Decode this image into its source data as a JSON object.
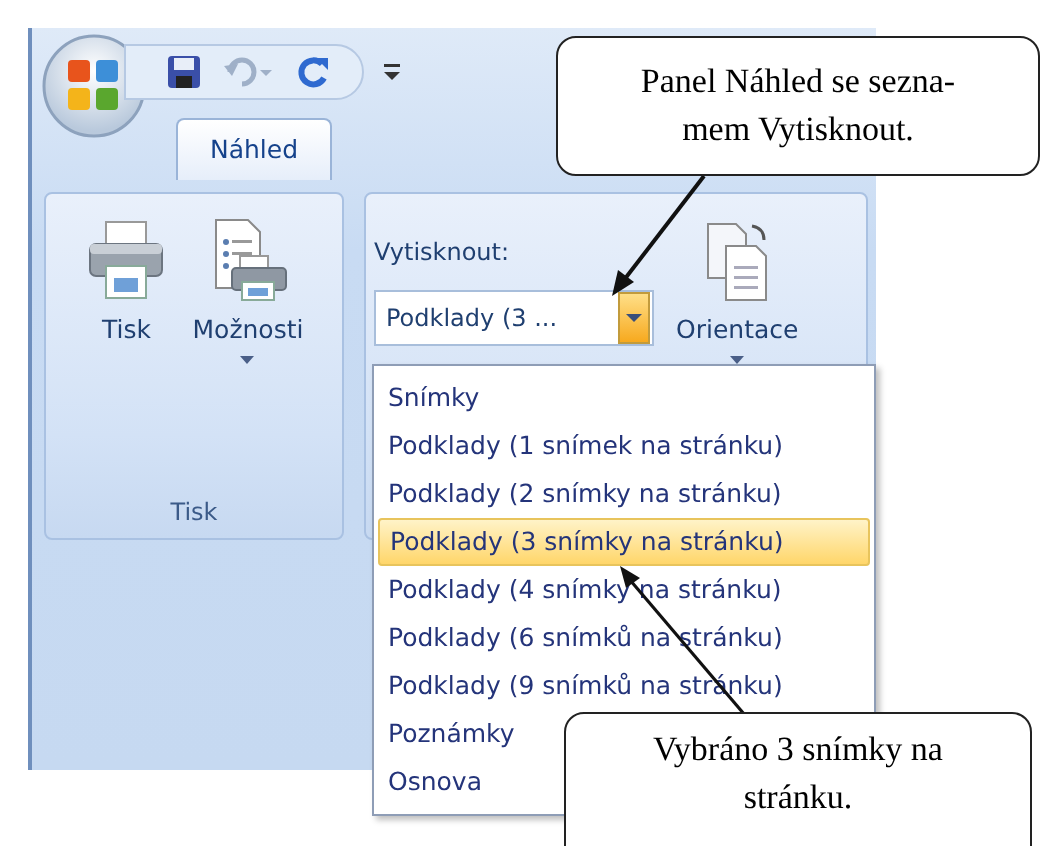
{
  "tabs": [
    {
      "label": "Náhled",
      "selected": true
    }
  ],
  "ribbon": {
    "print_group": {
      "label": "Tisk",
      "buttons": [
        {
          "label": "Tisk",
          "kind": "printer",
          "has_menu": false
        },
        {
          "label": "Možnosti",
          "kind": "options",
          "has_menu": true
        }
      ]
    },
    "layout_group": {
      "combo_label": "Vytisknout:",
      "combo_value": "Podklady (3 ...",
      "buttons": [
        {
          "label": "Orientace",
          "kind": "orientation",
          "has_menu": true
        }
      ]
    }
  },
  "dropdown": {
    "items": [
      {
        "label": "Snímky",
        "selected": false
      },
      {
        "label": "Podklady (1 snímek na stránku)",
        "selected": false
      },
      {
        "label": "Podklady (2 snímky na stránku)",
        "selected": false
      },
      {
        "label": "Podklady (3 snímky na stránku)",
        "selected": true
      },
      {
        "label": "Podklady (4 snímky na stránku)",
        "selected": false
      },
      {
        "label": "Podklady (6 snímků na stránku)",
        "selected": false
      },
      {
        "label": "Podklady (9 snímků na stránku)",
        "selected": false
      },
      {
        "label": "Poznámky",
        "selected": false
      },
      {
        "label": "Osnova",
        "selected": false
      }
    ]
  },
  "callouts": [
    {
      "lines": [
        "Panel Náhled se sezna-",
        "mem Vytisknout."
      ]
    },
    {
      "lines": [
        "Vybráno 3 snímky na",
        "stránku."
      ]
    }
  ]
}
